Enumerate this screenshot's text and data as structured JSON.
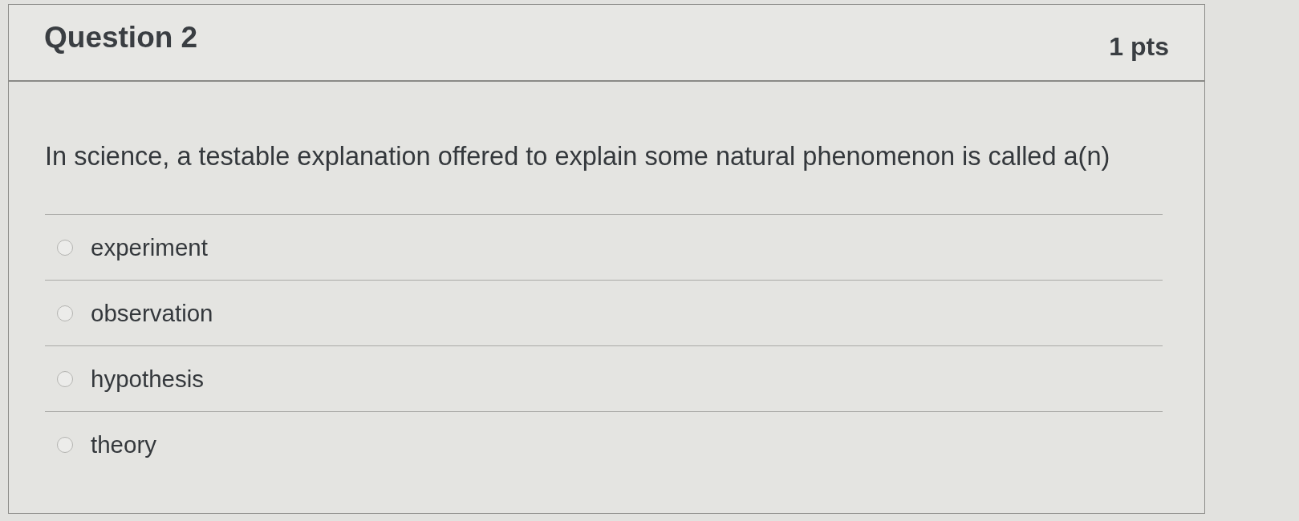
{
  "question": {
    "title": "Question 2",
    "points": "1 pts",
    "text": "In science, a testable explanation offered to explain some natural phenomenon is called a(n)",
    "options": [
      {
        "label": "experiment",
        "selected": false
      },
      {
        "label": "observation",
        "selected": false
      },
      {
        "label": "hypothesis",
        "selected": false
      },
      {
        "label": "theory",
        "selected": false
      }
    ]
  }
}
